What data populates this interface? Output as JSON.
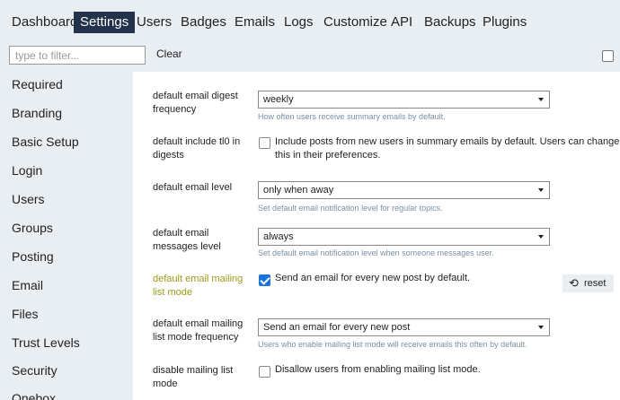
{
  "nav": {
    "tabs": [
      {
        "label": "Dashboard"
      },
      {
        "label": "Settings"
      },
      {
        "label": "Users"
      },
      {
        "label": "Badges"
      },
      {
        "label": "Emails"
      },
      {
        "label": "Logs"
      },
      {
        "label": "Customize"
      },
      {
        "label": "API"
      },
      {
        "label": "Backups"
      },
      {
        "label": "Plugins"
      }
    ],
    "active_tab": "Settings"
  },
  "filter": {
    "placeholder": "type to filter...",
    "value": "",
    "clear_label": "Clear"
  },
  "sidebar": {
    "items": [
      {
        "label": "Required"
      },
      {
        "label": "Branding"
      },
      {
        "label": "Basic Setup"
      },
      {
        "label": "Login"
      },
      {
        "label": "Users"
      },
      {
        "label": "Groups"
      },
      {
        "label": "Posting"
      },
      {
        "label": "Email"
      },
      {
        "label": "Files"
      },
      {
        "label": "Trust Levels"
      },
      {
        "label": "Security"
      },
      {
        "label": "Onebox"
      }
    ]
  },
  "settings": {
    "digest_frequency": {
      "label": "default email digest frequency",
      "value": "weekly",
      "help": "How often users receive summary emails by default."
    },
    "include_tl0": {
      "label": "default include tl0 in digests",
      "checked": false,
      "text": "Include posts from new users in summary emails by default. Users can change this in their preferences."
    },
    "email_level": {
      "label": "default email level",
      "value": "only when away",
      "help": "Set default email notification level for regular topics."
    },
    "messages_level": {
      "label": "default email messages level",
      "value": "always",
      "help": "Set default email notification level when someone messages user."
    },
    "mailing_list_mode": {
      "label": "default email mailing list mode",
      "checked": true,
      "text": "Send an email for every new post by default.",
      "reset_label": "reset"
    },
    "mailing_list_frequency": {
      "label": "default email mailing list mode frequency",
      "value": "Send an email for every new post",
      "help": "Users who enable mailing list mode will receive emails this often by default."
    },
    "disable_mailing_list": {
      "label": "disable mailing list mode",
      "checked": false,
      "text": "Disallow users from enabling mailing list mode."
    }
  }
}
